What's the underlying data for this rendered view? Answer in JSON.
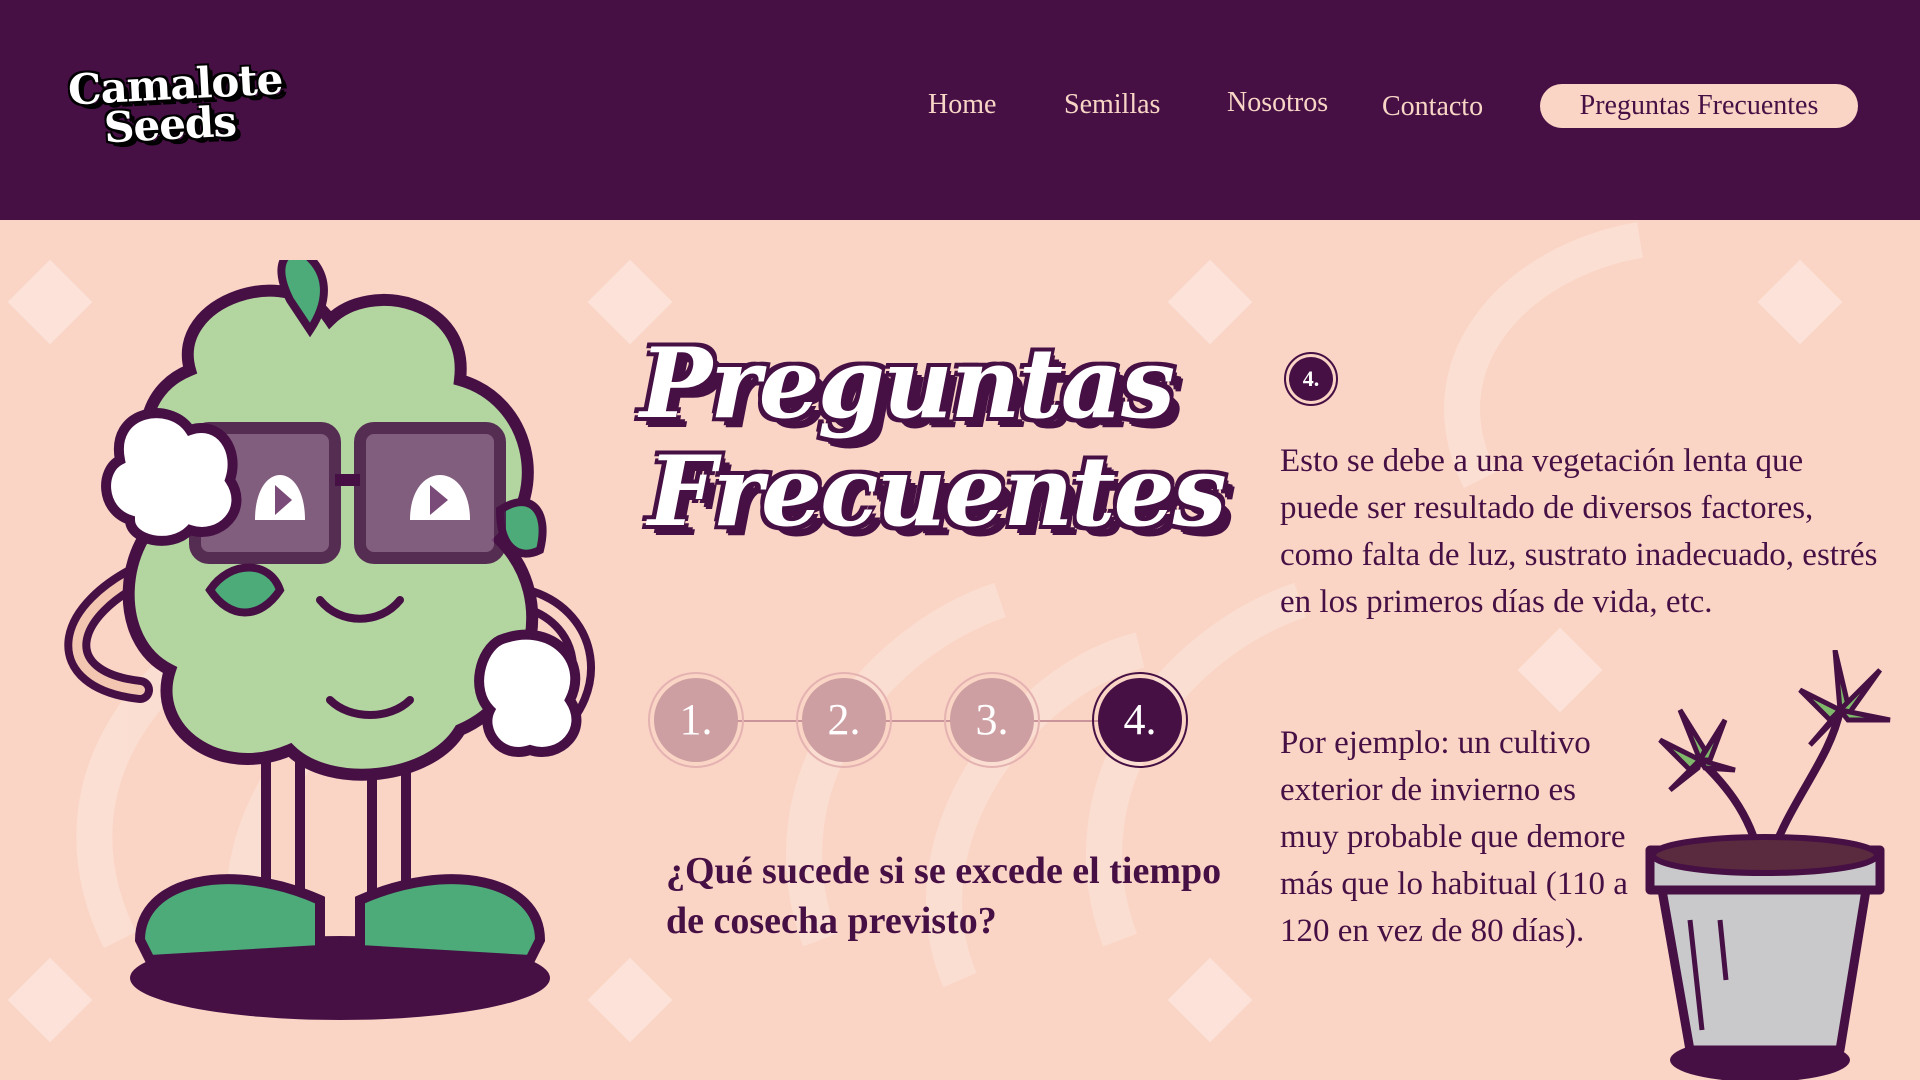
{
  "brand": {
    "logo_line1": "Camalote",
    "logo_line2": "Seeds"
  },
  "nav": {
    "items": [
      "Home",
      "Semillas",
      "Nosotros",
      "Contacto"
    ],
    "active_item": "Preguntas Frecuentes"
  },
  "hero": {
    "title_line1": "Preguntas",
    "title_line2": "Frecuentes"
  },
  "steps": {
    "items": [
      "1.",
      "2.",
      "3.",
      "4."
    ],
    "active_index": 3
  },
  "question": "¿Qué sucede si se excede el tiempo de cosecha previsto?",
  "answer": {
    "badge": "4.",
    "paragraph1": "Esto se debe a una vegetación lenta que puede ser resultado de diversos factores, como falta de luz, sustrato inadecuado, estrés en los primeros días de vida, etc.",
    "paragraph2": "Por ejemplo: un cultivo exterior de invierno es muy probable que demore más que lo habitual (110 a 120 en vez de 80 días)."
  },
  "colors": {
    "header_bg": "#461045",
    "page_bg": "#FAD5C5",
    "accent": "#461045",
    "step_inactive": "#CE9FA2"
  },
  "illustrations": {
    "mascot_icon": "cannabis-bud-mascot-icon",
    "plant_icon": "potted-plant-icon"
  }
}
